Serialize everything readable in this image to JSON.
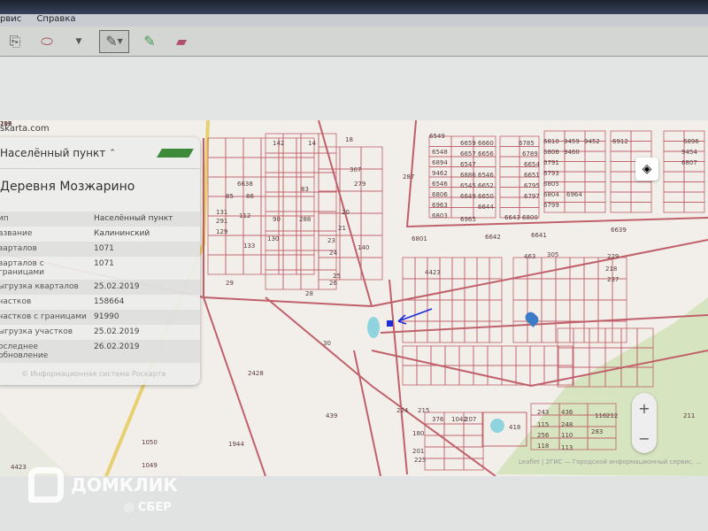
{
  "menu": {
    "items": [
      "рвис",
      "Справка"
    ]
  },
  "toolbar": {
    "icons": [
      "copy-icon",
      "stamp-icon",
      "dropdown-icon",
      "pencil-icon",
      "dropdown-icon",
      "green-pencil-icon",
      "eraser-icon"
    ]
  },
  "map": {
    "site": "skarta.com",
    "attribution": "Leaflet | 2ГИС — Городской информационный сервис, ...",
    "zoom_in": "+",
    "zoom_out": "−",
    "parcels": [
      "142",
      "14",
      "18",
      "287",
      "6549",
      "6659",
      "6660",
      "6785",
      "6810",
      "9459",
      "9452",
      "6912",
      "6896",
      "6548",
      "6657",
      "6656",
      "6789",
      "6808",
      "9460",
      "9454",
      "6894",
      "6547",
      "6654",
      "6791",
      "6807",
      "9462",
      "6886",
      "6546",
      "6651",
      "6793",
      "6806",
      "6546",
      "6545",
      "6652",
      "6795",
      "6805",
      "6963",
      "6649",
      "6650",
      "6797",
      "6804",
      "6964",
      "6644",
      "6799",
      "6803",
      "6965",
      "6643",
      "6800",
      "6801",
      "6642",
      "6641",
      "6639",
      "6638",
      "86",
      "85",
      "83",
      "112",
      "90",
      "288",
      "291",
      "129",
      "131",
      "133",
      "130",
      "140",
      "307",
      "279",
      "20",
      "21",
      "23",
      "24",
      "25",
      "26",
      "28",
      "29",
      "30",
      "2428",
      "439",
      "1944",
      "1050",
      "1049",
      "4423",
      "4423",
      "463",
      "305",
      "229",
      "218",
      "237",
      "418",
      "243",
      "436",
      "115",
      "248",
      "256",
      "110",
      "118",
      "113",
      "283",
      "116",
      "212",
      "211",
      "376",
      "1042",
      "207",
      "180",
      "201",
      "225",
      "224",
      "215",
      "216",
      "209",
      "197"
    ]
  },
  "panel": {
    "header": "Населённый пункт",
    "title": "Деревня Мозжарино",
    "rows": [
      {
        "k": "ип",
        "v": "Населённый пункт"
      },
      {
        "k": "азвание",
        "v": "Калининский"
      },
      {
        "k": "варталов",
        "v": "1071"
      },
      {
        "k": "варталов с границами",
        "v": "1071"
      },
      {
        "k": "ыгрузка кварталов",
        "v": "25.02.2019"
      },
      {
        "k": "частков",
        "v": "158664"
      },
      {
        "k": "частков с границами",
        "v": "91990"
      },
      {
        "k": "ыгрузка участков",
        "v": "25.02.2019"
      },
      {
        "k": "оследнее обновление",
        "v": "26.02.2019"
      }
    ],
    "footer": "© Информационная система Роскарта"
  },
  "watermark": {
    "brand": "ДОМКЛИК",
    "sub": "СБЕР"
  },
  "colors": {
    "parcel_line": "#c0606a",
    "map_bg": "#f2efea",
    "forest": "#d6e4c0",
    "water": "#8fd3de",
    "marker": "#1d2bd8"
  }
}
